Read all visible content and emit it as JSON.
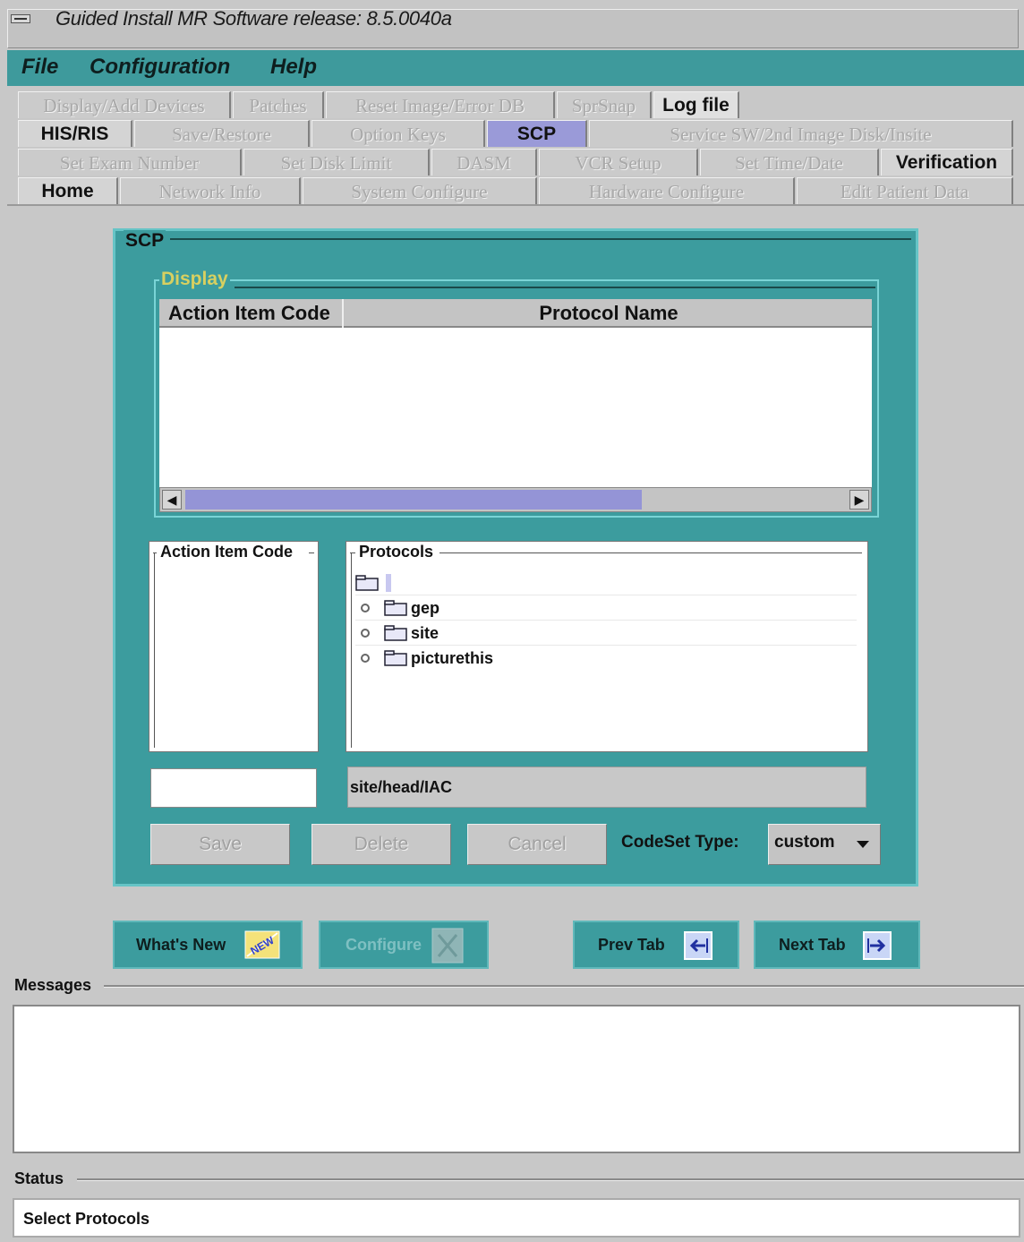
{
  "window": {
    "title": "Guided Install  MR Software release: 8.5.0040a"
  },
  "menubar": {
    "items": [
      "File",
      "Configuration",
      "Help"
    ]
  },
  "tabs": {
    "row1": [
      "Display/Add Devices",
      "Patches",
      "Reset Image/Error DB",
      "SprSnap",
      "Log file"
    ],
    "row2": [
      "HIS/RIS",
      "Save/Restore",
      "Option Keys",
      "SCP",
      "Service SW/2nd Image Disk/Insite"
    ],
    "row3": [
      "Set Exam Number",
      "Set Disk Limit",
      "DASM",
      "VCR Setup",
      "Set Time/Date",
      "Verification"
    ],
    "row4": [
      "Home",
      "Network Info",
      "System Configure",
      "Hardware Configure",
      "Edit Patient Data"
    ],
    "active": "SCP"
  },
  "scp": {
    "title": "SCP",
    "display": {
      "label": "Display",
      "columns": [
        "Action Item Code",
        "Protocol Name"
      ],
      "rows": []
    },
    "action_item_code_list": {
      "label": "Action Item Code"
    },
    "protocols": {
      "label": "Protocols",
      "items": [
        "gep",
        "site",
        "picturethis"
      ]
    },
    "action_item_code_value": "",
    "path_value": "site/head/IAC",
    "buttons": {
      "save": "Save",
      "delete": "Delete",
      "cancel": "Cancel"
    },
    "codeset": {
      "label": "CodeSet Type:",
      "value": "custom"
    }
  },
  "nav": {
    "whats_new": "What's New",
    "whats_new_badge": "NEW",
    "configure": "Configure",
    "prev_tab": "Prev Tab",
    "next_tab": "Next Tab"
  },
  "messages": {
    "label": "Messages",
    "text": ""
  },
  "status": {
    "label": "Status",
    "text": "Select Protocols"
  },
  "colors": {
    "teal": "#3c9c9e",
    "active_tab": "#9a9ad8",
    "display_label": "#d8d060"
  }
}
